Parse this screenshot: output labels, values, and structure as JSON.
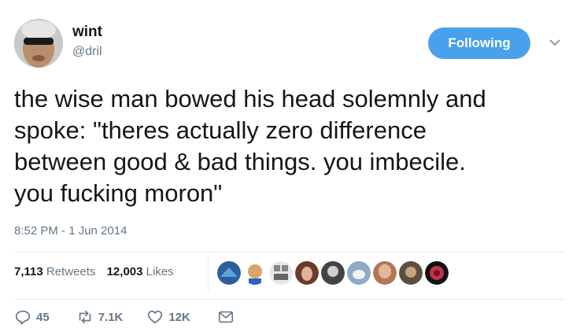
{
  "author": {
    "name": "wint",
    "handle": "@dril"
  },
  "follow_button": {
    "label": "Following",
    "color": "#4aa1eb"
  },
  "tweet": {
    "text": "the wise man bowed his head solemnly and\nspoke: \"theres actually zero difference\nbetween good & bad things. you imbecile.\nyou fucking moron\"",
    "timestamp": "8:52 PM - 1 Jun 2014"
  },
  "stats": {
    "retweets_count": "7,113",
    "retweets_label": "Retweets",
    "likes_count": "12,003",
    "likes_label": "Likes"
  },
  "likers": [
    {
      "icon": "liker-avatar",
      "color": "#2b5f9e"
    },
    {
      "icon": "liker-avatar",
      "color": "#d9a46b"
    },
    {
      "icon": "liker-avatar",
      "color": "#e8e8e8"
    },
    {
      "icon": "liker-avatar",
      "color": "#6b3b2a"
    },
    {
      "icon": "liker-avatar",
      "color": "#444444"
    },
    {
      "icon": "liker-avatar",
      "color": "#8fa9c8"
    },
    {
      "icon": "liker-avatar",
      "color": "#b0785a"
    },
    {
      "icon": "liker-avatar",
      "color": "#5a5040"
    },
    {
      "icon": "liker-avatar",
      "color": "#c0334a"
    }
  ],
  "actions": {
    "reply_count": "45",
    "retweet_count": "7.1K",
    "like_count": "12K"
  },
  "colors": {
    "text": "#14171a",
    "secondary": "#657786",
    "divider": "#e6ecf0"
  }
}
